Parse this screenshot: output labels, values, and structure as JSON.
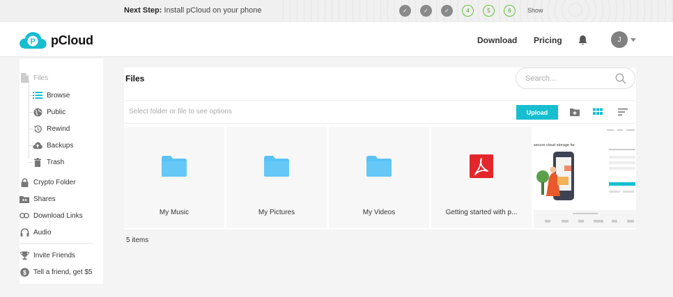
{
  "next_step": {
    "label_bold": "Next Step:",
    "label_text": "Install pCloud on your phone",
    "steps": [
      {
        "state": "done",
        "text": "✓"
      },
      {
        "state": "done",
        "text": "✓"
      },
      {
        "state": "done",
        "text": "✓"
      },
      {
        "state": "todo",
        "text": "4"
      },
      {
        "state": "todo",
        "text": "5"
      },
      {
        "state": "todo",
        "text": "6"
      }
    ],
    "show_label": "Show"
  },
  "header": {
    "brand": "pCloud",
    "nav": {
      "download": "Download",
      "pricing": "Pricing"
    },
    "avatar_initial": "J",
    "icons": {
      "bell": "bell-icon",
      "caret": "chevron-down-icon"
    }
  },
  "sidebar": {
    "files": "Files",
    "browse": "Browse",
    "public": "Public",
    "rewind": "Rewind",
    "backups": "Backups",
    "trash": "Trash",
    "crypto": "Crypto Folder",
    "shares": "Shares",
    "download_links": "Download Links",
    "audio": "Audio",
    "invite": "Invite Friends",
    "tell_friend": "Tell a friend, get $5"
  },
  "main": {
    "title": "Files",
    "search_placeholder": "Search...",
    "hint": "Select folder or file to see options",
    "upload_label": "Upload",
    "items": [
      {
        "name": "My Music",
        "kind": "folder"
      },
      {
        "name": "My Pictures",
        "kind": "folder"
      },
      {
        "name": "My Videos",
        "kind": "folder"
      },
      {
        "name": "Getting started with p...",
        "kind": "pdf"
      }
    ],
    "preview_text": "secure cloud storage for",
    "item_count": "5 items"
  },
  "colors": {
    "accent": "#17bed0",
    "folder": "#5bc2f5",
    "pdf": "#e3262b",
    "step_done": "#8a8a8a",
    "step_todo": "#67c33a"
  }
}
